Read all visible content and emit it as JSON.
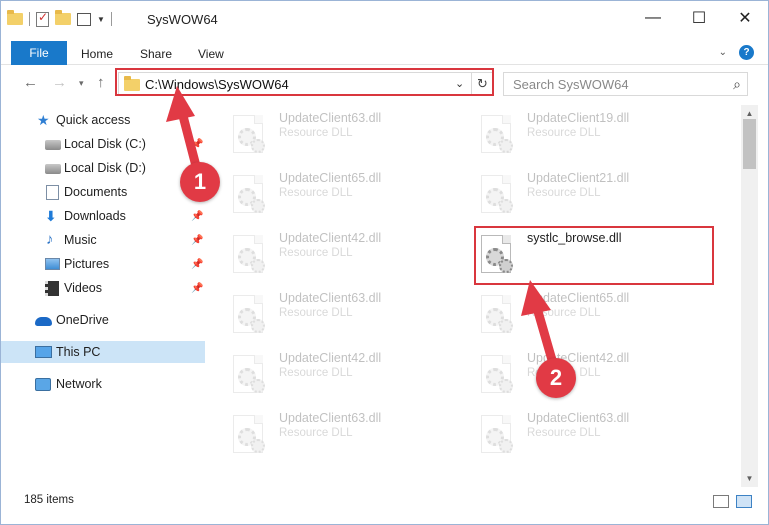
{
  "window": {
    "title": "SysWOW64",
    "controls": {
      "minimize": "—",
      "maximize": "☐",
      "close": "✕"
    }
  },
  "ribbon": {
    "tabs": [
      {
        "label": "File"
      },
      {
        "label": "Home"
      },
      {
        "label": "Share"
      },
      {
        "label": "View"
      }
    ],
    "help": "?"
  },
  "address_bar": {
    "path": "C:\\Windows\\SysWOW64",
    "search_placeholder": "Search SysWOW64"
  },
  "nav_pane": {
    "items": [
      {
        "label": "Quick access",
        "icon": "star-icon",
        "pinned": false
      },
      {
        "label": "Local Disk (C:)",
        "icon": "drive-icon",
        "pinned": true
      },
      {
        "label": "Local Disk (D:)",
        "icon": "drive-icon",
        "pinned": false
      },
      {
        "label": "Documents",
        "icon": "documents-icon",
        "pinned": true
      },
      {
        "label": "Downloads",
        "icon": "downloads-icon",
        "pinned": true
      },
      {
        "label": "Music",
        "icon": "music-icon",
        "pinned": true
      },
      {
        "label": "Pictures",
        "icon": "pictures-icon",
        "pinned": true
      },
      {
        "label": "Videos",
        "icon": "videos-icon",
        "pinned": true
      },
      {
        "label": "OneDrive",
        "icon": "onedrive-icon",
        "pinned": false
      },
      {
        "label": "This PC",
        "icon": "this-pc-icon",
        "pinned": false,
        "selected": true
      },
      {
        "label": "Network",
        "icon": "network-icon",
        "pinned": false
      }
    ]
  },
  "files": {
    "left_column": [
      {
        "name": "UpdateClient63.dll",
        "type": "Resource DLL"
      },
      {
        "name": "UpdateClient65.dll",
        "type": "Resource DLL"
      },
      {
        "name": "UpdateClient42.dll",
        "type": "Resource DLL"
      },
      {
        "name": "UpdateClient63.dll",
        "type": "Resource DLL"
      },
      {
        "name": "UpdateClient42.dll",
        "type": "Resource DLL"
      },
      {
        "name": "UpdateClient63.dll",
        "type": "Resource DLL"
      }
    ],
    "right_column": [
      {
        "name": "UpdateClient19.dll",
        "type": "Resource DLL"
      },
      {
        "name": "UpdateClient21.dll",
        "type": "Resource DLL"
      },
      {
        "name": "systlc_browse.dll",
        "type": ""
      },
      {
        "name": "UpdateClient65.dll",
        "type": "Resource DLL"
      },
      {
        "name": "UpdateClient42.dll",
        "type": "Resource DLL"
      },
      {
        "name": "UpdateClient63.dll",
        "type": "Resource DLL"
      }
    ],
    "highlighted": "systlc_browse.dll"
  },
  "status_bar": {
    "item_count": "185 items"
  },
  "annotations": {
    "step1": "1",
    "step2": "2",
    "color": "#e13a45"
  }
}
